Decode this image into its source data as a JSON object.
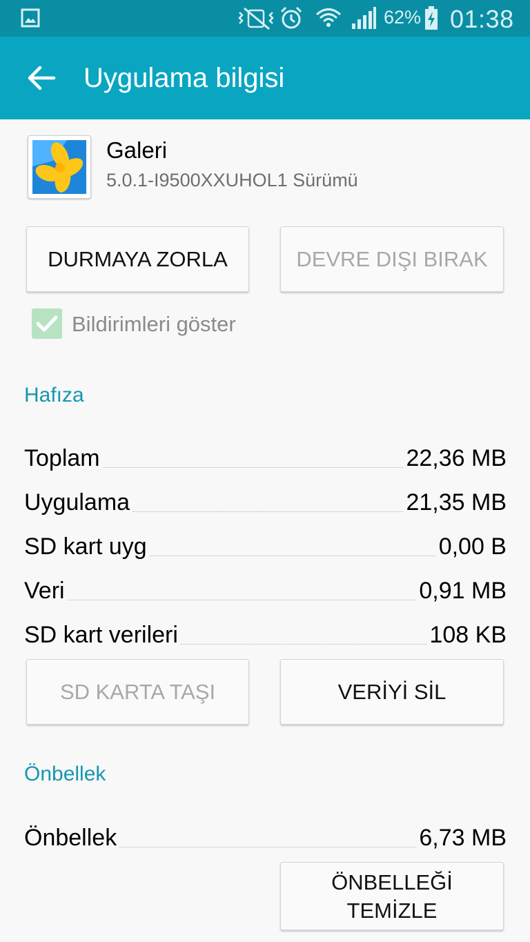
{
  "status_bar": {
    "battery_percent": "62%",
    "time": "01:38",
    "icons": [
      "gallery-notification-icon",
      "vibrate-mute-icon",
      "alarm-icon",
      "wifi-icon",
      "signal-icon",
      "battery-charging-icon"
    ]
  },
  "app_bar": {
    "title": "Uygulama bilgisi",
    "back_icon": "arrow-left-icon"
  },
  "app": {
    "name": "Galeri",
    "version": "5.0.1-I9500XXUHOL1 Sürümü",
    "icon": "gallery-app-icon"
  },
  "actions": {
    "force_stop": "DURMAYA ZORLA",
    "disable": "DEVRE DIŞI BIRAK"
  },
  "notifications": {
    "label": "Bildirimleri göster",
    "checked": true
  },
  "storage": {
    "title": "Hafıza",
    "rows": [
      {
        "label": "Toplam",
        "value": "22,36 MB"
      },
      {
        "label": "Uygulama",
        "value": "21,35 MB"
      },
      {
        "label": "SD kart uyg",
        "value": "0,00 B"
      },
      {
        "label": "Veri",
        "value": "0,91 MB"
      },
      {
        "label": "SD kart verileri",
        "value": "108 KB"
      }
    ],
    "move_to_sd": "SD KARTA TAŞI",
    "clear_data": "VERİYİ SİL"
  },
  "cache": {
    "title": "Önbellek",
    "row": {
      "label": "Önbellek",
      "value": "6,73 MB"
    },
    "clear_cache_line1": "ÖNBELLEĞİ",
    "clear_cache_line2": "TEMİZLE"
  },
  "colors": {
    "status_bar": "#0a8ea4",
    "app_bar": "#0aa6c1",
    "section_header": "#1597b0",
    "checkbox": "#b8e3c2"
  }
}
